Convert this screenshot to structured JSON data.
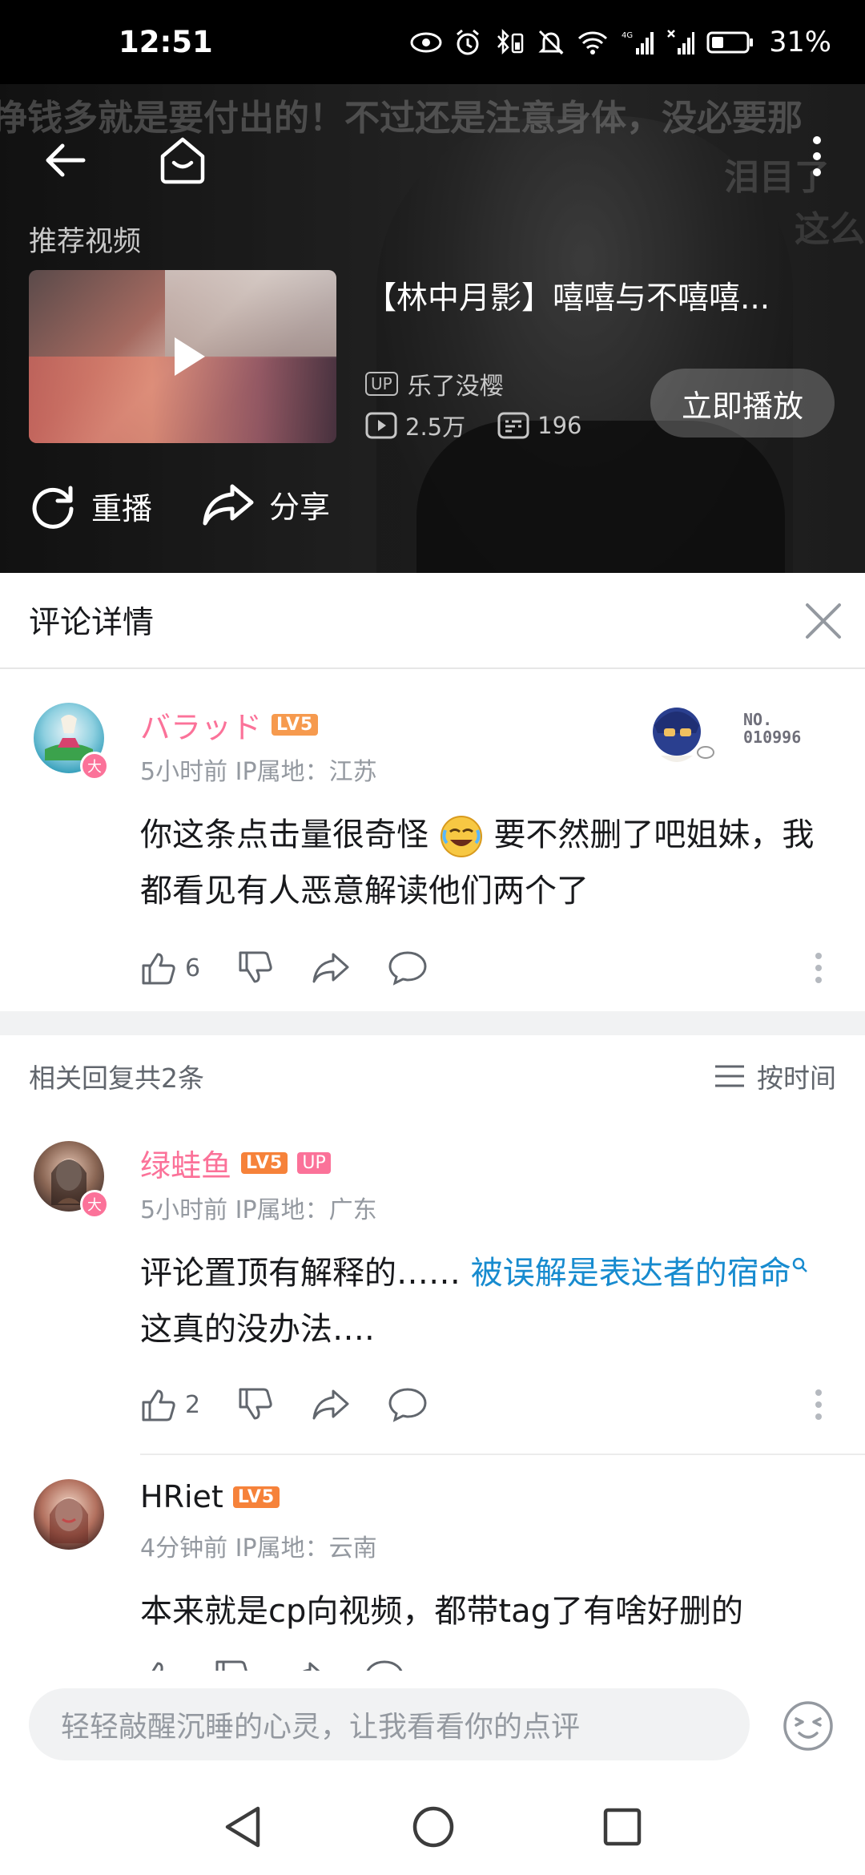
{
  "status_bar": {
    "time": "12:51",
    "battery": "31%",
    "network": "4G"
  },
  "video": {
    "subtitle_top": "挣钱多就是要付出的！不过还是注意身体，没必要那",
    "subtitle_mid": "泪目了",
    "subtitle_bottom": "这么",
    "recommend_label": "推荐视频",
    "recommend_title": "【林中月影】嘻嘻与不嘻嘻...",
    "up_tag": "UP",
    "recommend_author": "乐了没樱",
    "views": "2.5万",
    "danmaku": "196",
    "play_now": "立即播放",
    "replay": "重播",
    "share": "分享"
  },
  "comment_panel": {
    "title": "评论详情"
  },
  "main_comment": {
    "username": "バラッド",
    "level": "LV5",
    "time": "5小时前",
    "ip": "IP属地：江苏",
    "text_part1": "你这条点击量很奇怪",
    "text_part2": "要不然删了吧姐妹，我都看见有人恶意解读他们两个了",
    "likes": "6",
    "nameplate_label": "NO.",
    "nameplate_number": "010996",
    "avatar_badge": "大"
  },
  "replies_header": {
    "count_text": "相关回复共2条",
    "sort_label": "按时间"
  },
  "replies": [
    {
      "username": "绿蛙鱼",
      "level": "LV5",
      "up_badge": "UP",
      "time": "5小时前",
      "ip": "IP属地：广东",
      "text_before": "评论置顶有解释的…… ",
      "link_text": "被误解是表达者的宿命",
      "text_after": "这真的没办法….",
      "likes": "2",
      "avatar_badge": "大"
    },
    {
      "username": "HRiet",
      "level": "LV5",
      "time": "4分钟前",
      "ip": "IP属地：云南",
      "text": "本来就是cp向视频，都带tag了有啥好删的"
    }
  ],
  "input": {
    "placeholder": "轻轻敲醒沉睡的心灵，让我看看你的点评"
  },
  "colors": {
    "accent_pink": "#fb7299",
    "link_blue": "#178bcf",
    "level_orange": "#f6823a"
  }
}
